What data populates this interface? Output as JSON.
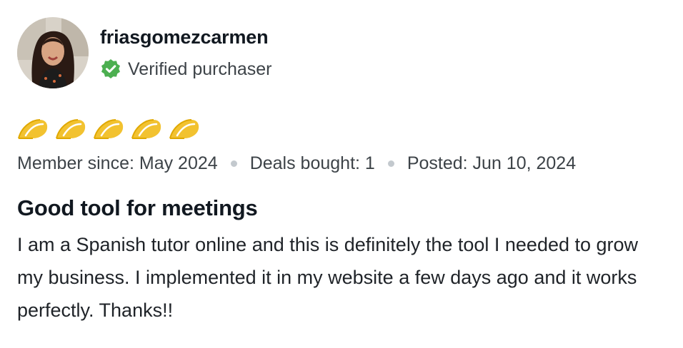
{
  "review": {
    "username": "friasgomezcarmen",
    "verified_label": "Verified purchaser",
    "rating": {
      "value": 5,
      "max": 5,
      "icon": "taco-icon",
      "color": "#f2c230"
    },
    "member_since": "Member since: May 2024",
    "deals_bought": "Deals bought: 1",
    "posted": "Posted: Jun 10, 2024",
    "title": "Good tool for meetings",
    "body": "I am a Spanish tutor online and this is definitely the tool I needed to grow my business. I implemented it in my website a few days ago and it works perfectly. Thanks!!"
  },
  "colors": {
    "verified_badge": "#4caf50",
    "taco_fill": "#f2c230",
    "taco_stroke": "#e0a800",
    "meta_dot": "#c3c9ce"
  }
}
